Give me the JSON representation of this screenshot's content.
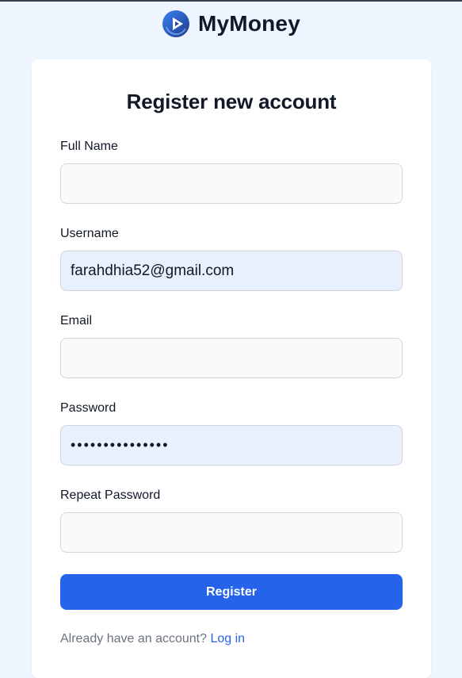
{
  "brand": {
    "name": "MyMoney",
    "logo_icon": "play-icon",
    "logo_color": "#1d4ed8"
  },
  "form": {
    "title": "Register new account",
    "fields": [
      {
        "label": "Full Name",
        "value": "",
        "type": "text"
      },
      {
        "label": "Username",
        "value": "farahdhia52@gmail.com",
        "type": "text"
      },
      {
        "label": "Email",
        "value": "",
        "type": "email"
      },
      {
        "label": "Password",
        "value": "•••••••••••••••",
        "type": "password"
      },
      {
        "label": "Repeat Password",
        "value": "",
        "type": "password"
      }
    ],
    "submit_label": "Register",
    "footer_text": "Already have an account?",
    "login_link": "Log in"
  },
  "colors": {
    "accent": "#2563eb",
    "page_background": "#eef5ff",
    "autofill_background": "#e8f0fe"
  }
}
